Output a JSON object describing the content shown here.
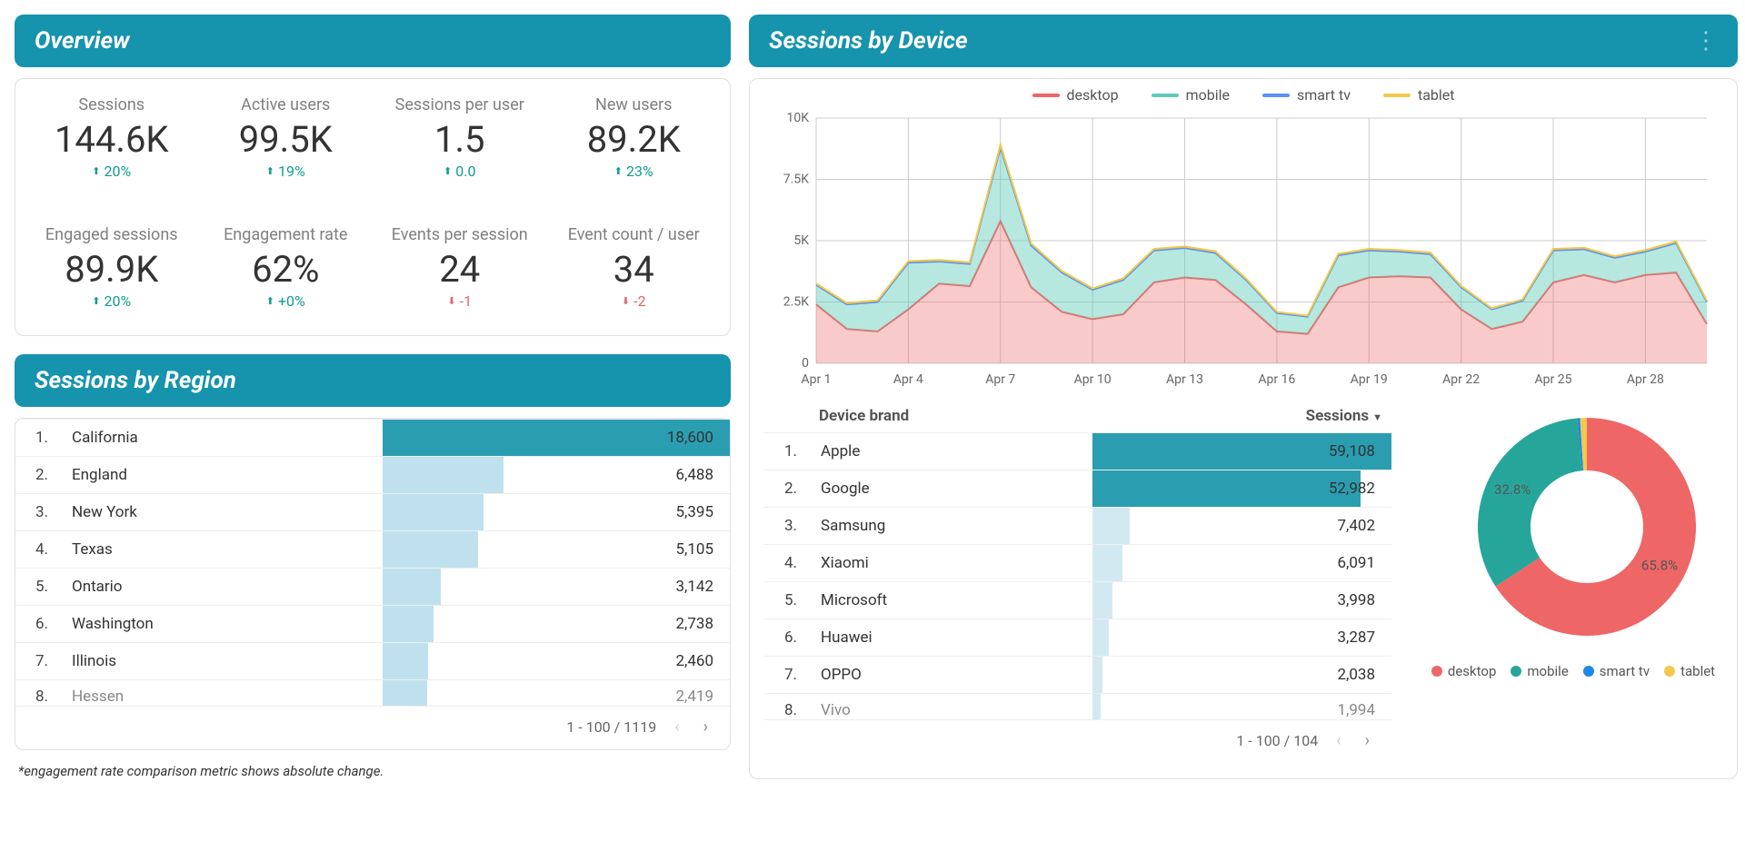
{
  "overview": {
    "title": "Overview",
    "metrics": [
      {
        "label": "Sessions",
        "value": "144.6K",
        "delta": "20%",
        "dir": "up"
      },
      {
        "label": "Active users",
        "value": "99.5K",
        "delta": "19%",
        "dir": "up"
      },
      {
        "label": "Sessions per user",
        "value": "1.5",
        "delta": "0.0",
        "dir": "up"
      },
      {
        "label": "New users",
        "value": "89.2K",
        "delta": "23%",
        "dir": "up"
      },
      {
        "label": "Engaged sessions",
        "value": "89.9K",
        "delta": "20%",
        "dir": "up"
      },
      {
        "label": "Engagement rate",
        "value": "62%",
        "delta": "+0%",
        "dir": "up"
      },
      {
        "label": "Events per session",
        "value": "24",
        "delta": "-1",
        "dir": "down"
      },
      {
        "label": "Event count / user",
        "value": "34",
        "delta": "-2",
        "dir": "down"
      }
    ]
  },
  "regions": {
    "title": "Sessions by Region",
    "rows": [
      {
        "idx": "1.",
        "name": "California",
        "value": "18,600",
        "num": 18600
      },
      {
        "idx": "2.",
        "name": "England",
        "value": "6,488",
        "num": 6488
      },
      {
        "idx": "3.",
        "name": "New York",
        "value": "5,395",
        "num": 5395
      },
      {
        "idx": "4.",
        "name": "Texas",
        "value": "5,105",
        "num": 5105
      },
      {
        "idx": "5.",
        "name": "Ontario",
        "value": "3,142",
        "num": 3142
      },
      {
        "idx": "6.",
        "name": "Washington",
        "value": "2,738",
        "num": 2738
      },
      {
        "idx": "7.",
        "name": "Illinois",
        "value": "2,460",
        "num": 2460
      }
    ],
    "partial": {
      "idx": "8.",
      "name": "Hessen",
      "value": "2,419"
    },
    "pager": "1 - 100 / 1119"
  },
  "devices": {
    "title": "Sessions by Device",
    "chart_legend": [
      {
        "name": "desktop",
        "color": "#ee6666"
      },
      {
        "name": "mobile",
        "color": "#5ecbb8"
      },
      {
        "name": "smart tv",
        "color": "#5b8ff9"
      },
      {
        "name": "tablet",
        "color": "#f2c94c"
      }
    ],
    "brand_header": {
      "col1": "Device brand",
      "col2": "Sessions"
    },
    "brands": [
      {
        "idx": "1.",
        "name": "Apple",
        "value": "59,108",
        "num": 59108
      },
      {
        "idx": "2.",
        "name": "Google",
        "value": "52,982",
        "num": 52982
      },
      {
        "idx": "3.",
        "name": "Samsung",
        "value": "7,402",
        "num": 7402
      },
      {
        "idx": "4.",
        "name": "Xiaomi",
        "value": "6,091",
        "num": 6091
      },
      {
        "idx": "5.",
        "name": "Microsoft",
        "value": "3,998",
        "num": 3998
      },
      {
        "idx": "6.",
        "name": "Huawei",
        "value": "3,287",
        "num": 3287
      },
      {
        "idx": "7.",
        "name": "OPPO",
        "value": "2,038",
        "num": 2038
      }
    ],
    "brands_partial": {
      "idx": "8.",
      "name": "Vivo",
      "value": "1,994"
    },
    "brands_pager": "1 - 100 / 104",
    "donut": {
      "slices": [
        {
          "name": "desktop",
          "pct": 65.8,
          "color": "#ee6666",
          "label": "65.8%"
        },
        {
          "name": "mobile",
          "pct": 32.8,
          "color": "#26a69a",
          "label": "32.8%"
        },
        {
          "name": "smart tv",
          "pct": 0.4,
          "color": "#1e88e5"
        },
        {
          "name": "tablet",
          "pct": 1.0,
          "color": "#f2c94c"
        }
      ]
    }
  },
  "chart_data": {
    "type": "area",
    "title": "Sessions by Device",
    "x_ticks": [
      "Apr 1",
      "Apr 4",
      "Apr 7",
      "Apr 10",
      "Apr 13",
      "Apr 16",
      "Apr 19",
      "Apr 22",
      "Apr 25",
      "Apr 28"
    ],
    "ylim": [
      0,
      10000
    ],
    "y_ticks": [
      "0",
      "2.5K",
      "5K",
      "7.5K",
      "10K"
    ],
    "x": [
      "Apr 1",
      "Apr 2",
      "Apr 3",
      "Apr 4",
      "Apr 5",
      "Apr 6",
      "Apr 7",
      "Apr 8",
      "Apr 9",
      "Apr 10",
      "Apr 11",
      "Apr 12",
      "Apr 13",
      "Apr 14",
      "Apr 15",
      "Apr 16",
      "Apr 17",
      "Apr 18",
      "Apr 19",
      "Apr 20",
      "Apr 21",
      "Apr 22",
      "Apr 23",
      "Apr 24",
      "Apr 25",
      "Apr 26",
      "Apr 27",
      "Apr 28",
      "Apr 29",
      "Apr 30"
    ],
    "series": [
      {
        "name": "desktop",
        "color": "#ee6666",
        "values": [
          2400,
          1400,
          1300,
          2200,
          3250,
          3150,
          5800,
          3100,
          2100,
          1800,
          2000,
          3300,
          3500,
          3400,
          2400,
          1300,
          1200,
          3100,
          3500,
          3550,
          3500,
          2200,
          1400,
          1700,
          3300,
          3600,
          3300,
          3600,
          3700,
          1600
        ]
      },
      {
        "name": "mobile",
        "color": "#5ecbb8",
        "values": [
          800,
          1000,
          1200,
          1900,
          900,
          900,
          3000,
          1700,
          1600,
          1200,
          1400,
          1300,
          1200,
          1100,
          1000,
          750,
          700,
          1300,
          1100,
          1000,
          950,
          900,
          800,
          850,
          1300,
          1050,
          1000,
          950,
          1200,
          900
        ]
      },
      {
        "name": "smart tv",
        "color": "#5b8ff9",
        "values": [
          5,
          5,
          5,
          5,
          5,
          5,
          5,
          5,
          5,
          5,
          5,
          5,
          5,
          5,
          5,
          5,
          5,
          5,
          5,
          5,
          5,
          5,
          5,
          5,
          5,
          5,
          5,
          5,
          5,
          5
        ]
      },
      {
        "name": "tablet",
        "color": "#f2c94c",
        "values": [
          50,
          50,
          60,
          60,
          60,
          60,
          100,
          80,
          60,
          50,
          60,
          60,
          60,
          60,
          50,
          40,
          40,
          60,
          60,
          60,
          60,
          50,
          40,
          50,
          60,
          60,
          60,
          60,
          60,
          50
        ]
      }
    ]
  },
  "footnote": "*engagement rate comparison metric shows absolute change."
}
